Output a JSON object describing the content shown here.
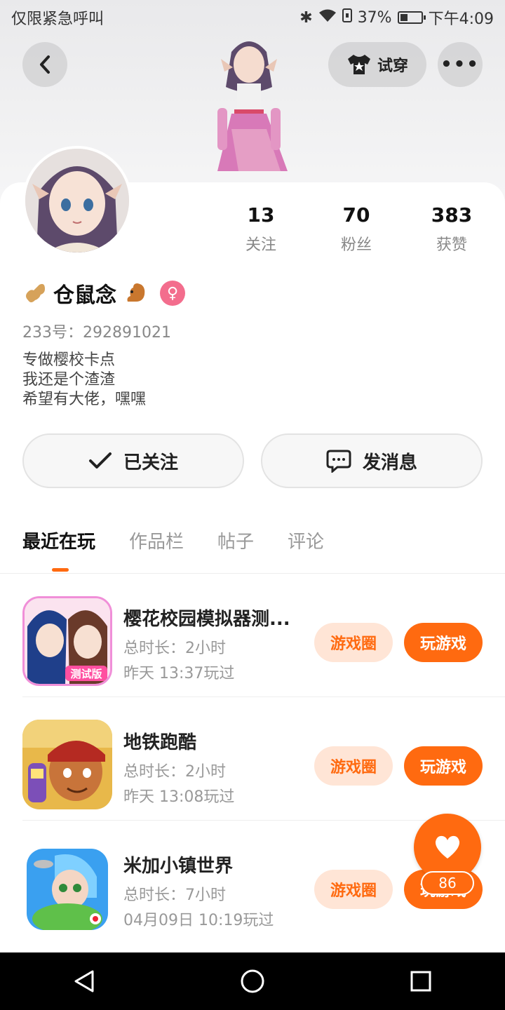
{
  "status_bar": {
    "carrier": "仅限紧急呼叫",
    "battery": "37%",
    "time": "下午4:09"
  },
  "header": {
    "try_on_label": "试穿",
    "more_label": "•••"
  },
  "profile": {
    "stats": [
      {
        "value": "13",
        "label": "关注"
      },
      {
        "value": "70",
        "label": "粉丝"
      },
      {
        "value": "383",
        "label": "获赞"
      }
    ],
    "name": "仓鼠念",
    "uid": "233号：292891021",
    "bio": [
      "专做樱校卡点",
      "我还是个渣渣",
      "希望有大佬，嘿嘿"
    ],
    "gender_symbol": "♀"
  },
  "actions": {
    "follow_label": "已关注",
    "message_label": "发消息"
  },
  "tabs": [
    "最近在玩",
    "作品栏",
    "帖子",
    "评论"
  ],
  "games": [
    {
      "title": "樱花校园模拟器测...",
      "duration": "总时长：2小时",
      "last_played": "昨天 13:37玩过",
      "badge": "测试版"
    },
    {
      "title": "地铁跑酷",
      "duration": "总时长：2小时",
      "last_played": "昨天 13:08玩过"
    },
    {
      "title": "米加小镇世界",
      "duration": "总时长：7小时",
      "last_played": "04月09日 10:19玩过"
    }
  ],
  "game_buttons": {
    "circle": "游戏圈",
    "play": "玩游戏"
  },
  "fab": {
    "count": "86"
  },
  "colors": {
    "accent": "#ff6a10",
    "accent_light": "#ffe5d6",
    "gender_pink": "#f36d8d"
  }
}
